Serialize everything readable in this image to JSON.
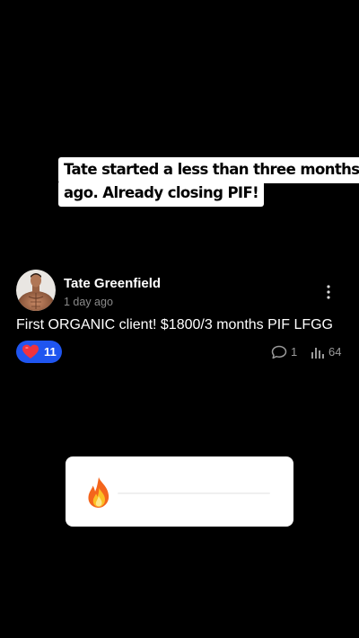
{
  "caption": {
    "line1": "Tate started a less than three months",
    "line2": "ago. Already closing PIF!"
  },
  "post": {
    "author_name": "Tate Greenfield",
    "time": "1 day ago",
    "text": "First ORGANIC client! $1800/3 months PIF LFGG",
    "reaction": {
      "icon": "heart-icon",
      "count": "11",
      "color": "#1f55f0"
    },
    "comments": {
      "icon": "comment-icon",
      "count": "1"
    },
    "views": {
      "icon": "bar-chart-icon",
      "count": "64"
    },
    "menu_icon": "more-vertical-icon"
  },
  "reply_card": {
    "emoji": "fire-icon",
    "progress": 0
  }
}
